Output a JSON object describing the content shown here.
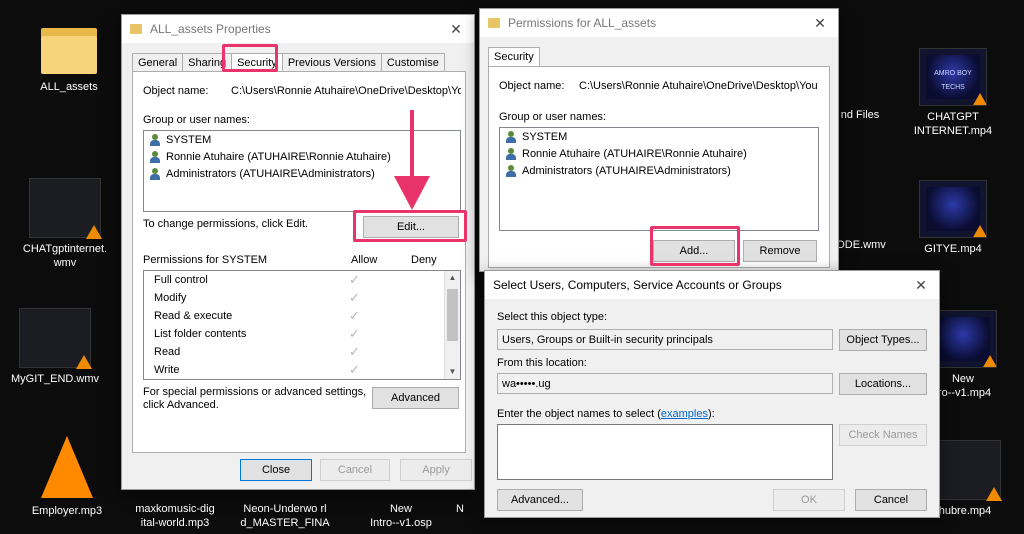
{
  "desktop": {
    "items": [
      {
        "label": "ALL_assets"
      },
      {
        "label": "CHATgptinternet.\nwmv"
      },
      {
        "label": "MyGIT_END.wmv"
      },
      {
        "label": "Employer.mp3"
      },
      {
        "label": "maxkomusic-dig\nital-world.mp3"
      },
      {
        "label": "Neon-Underwo rl\nd_MASTER_FINA"
      },
      {
        "label": "New\nIntro--v1.osp"
      },
      {
        "label": "N"
      },
      {
        "label": "nd Files"
      },
      {
        "label": "CHATGPT\nINTERNET.mp4"
      },
      {
        "label": "ODE.wmv"
      },
      {
        "label": "GITYE.mp4"
      },
      {
        "label": "New\ntro--v1.mp4"
      },
      {
        "label": "hubre.mp4"
      }
    ],
    "thumb_text": "AMRO BOY\nTECHS"
  },
  "properties": {
    "title": "ALL_assets Properties",
    "tabs": [
      "General",
      "Sharing",
      "Security",
      "Previous Versions",
      "Customise"
    ],
    "object_name_label": "Object name:",
    "object_name_value": "C:\\Users\\Ronnie Atuhaire\\OneDrive\\Desktop\\You",
    "group_label": "Group or user names:",
    "users": [
      "SYSTEM",
      "Ronnie Atuhaire (ATUHAIRE\\Ronnie Atuhaire)",
      "Administrators (ATUHAIRE\\Administrators)"
    ],
    "change_text": "To change permissions, click Edit.",
    "edit_label": "Edit...",
    "perm_label": "Permissions for SYSTEM",
    "allow_label": "Allow",
    "deny_label": "Deny",
    "permissions": [
      "Full control",
      "Modify",
      "Read & execute",
      "List folder contents",
      "Read",
      "Write"
    ],
    "special_text_1": "For special permissions or advanced settings,",
    "special_text_2": "click Advanced.",
    "advanced_label": "Advanced",
    "close_label": "Close",
    "cancel_label": "Cancel",
    "apply_label": "Apply"
  },
  "permissions_dialog": {
    "title": "Permissions for ALL_assets",
    "tab": "Security",
    "object_name_label": "Object name:",
    "object_name_value": "C:\\Users\\Ronnie Atuhaire\\OneDrive\\Desktop\\You",
    "group_label": "Group or user names:",
    "users": [
      "SYSTEM",
      "Ronnie Atuhaire (ATUHAIRE\\Ronnie Atuhaire)",
      "Administrators (ATUHAIRE\\Administrators)"
    ],
    "add_label": "Add...",
    "remove_label": "Remove"
  },
  "select_dialog": {
    "title": "Select Users, Computers, Service Accounts or Groups",
    "object_type_label": "Select this object type:",
    "object_type_value": "Users, Groups or Built-in security principals",
    "object_types_btn": "Object Types...",
    "location_label": "From this location:",
    "location_value": "wa•••••.ug",
    "locations_btn": "Locations...",
    "enter_label": "Enter the object names to select (",
    "examples_link": "examples",
    "enter_label_end": "):",
    "check_names_btn": "Check Names",
    "advanced_btn": "Advanced...",
    "ok_btn": "OK",
    "cancel_btn": "Cancel"
  },
  "colors": {
    "highlight": "#e8336b",
    "accent": "#0078d7"
  }
}
